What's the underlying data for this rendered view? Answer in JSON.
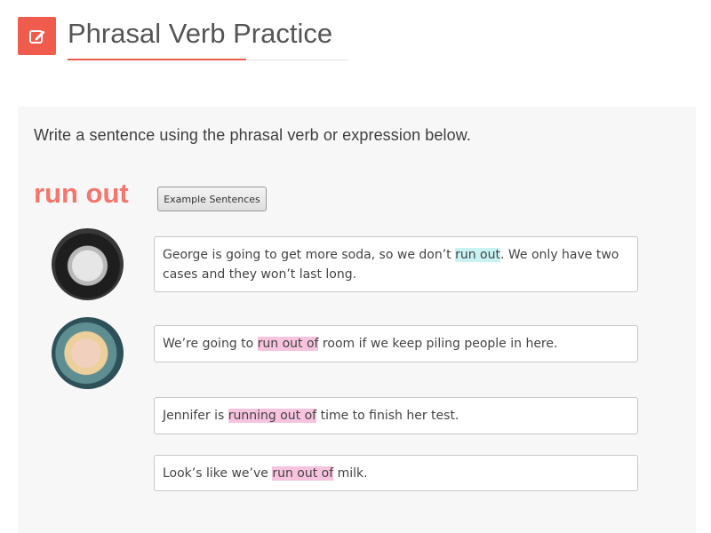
{
  "header": {
    "title": "Phrasal Verb Practice",
    "icon": "edit-icon",
    "accent_color": "#ef5b4c"
  },
  "exercise": {
    "instruction": "Write a sentence using the phrasal verb or expression below.",
    "phrase": "run out",
    "phrase_color": "#f4766c",
    "example_button_label": "Example Sentences"
  },
  "sentences": [
    {
      "before": "George is going to get more soda, so we don’t ",
      "highlight": "run out",
      "after": ". We only have two cases and they won’t last long.",
      "highlight_color": "#c9f3f3"
    },
    {
      "before": "We’re going to ",
      "highlight": "run out of",
      "after": " room if we keep piling people in here.",
      "highlight_color": "#f7c3de"
    },
    {
      "before": "Jennifer is ",
      "highlight": "running out of",
      "after": " time to finish her test.",
      "highlight_color": "#f7c3de"
    },
    {
      "before": "Look’s like we’ve ",
      "highlight": "run out of",
      "after": " milk.",
      "highlight_color": "#f7c3de"
    }
  ]
}
